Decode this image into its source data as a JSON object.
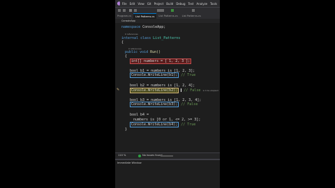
{
  "menu": {
    "items": [
      "File",
      "Edit",
      "View",
      "Git",
      "Project",
      "Build",
      "Debug",
      "Test",
      "Analyze",
      "Tools"
    ]
  },
  "tabs": [
    {
      "label": "Program.cs",
      "active": false
    },
    {
      "label": "List Patterns.cs",
      "active": true
    },
    {
      "label": "List Patterns.cs",
      "active": false
    },
    {
      "label": "List Patterns.cs",
      "active": false
    }
  ],
  "navbar": {
    "project": "ConsoleApp"
  },
  "code": {
    "line1": {
      "kw": "namespace",
      "name": "ConsoleApp;"
    },
    "refs1": "0 references",
    "line2": {
      "kw": "internal class",
      "name": "List_Patterns"
    },
    "brace_open": "{",
    "refs2": "0 references",
    "line3": {
      "kw": "public void",
      "name": "Run()"
    },
    "brace_open2": "{",
    "line4": "int[] numbers = [ 1, 2, 3 ];",
    "line5": "bool b1 = numbers is [1, 2, 3];",
    "line6": {
      "call": "Console.WriteLine(b1);",
      "comment": "// True"
    },
    "line7": "bool b2 = numbers is [1, 2, 4];",
    "line8": {
      "call": "Console.WriteLine(b2);",
      "comment": "// False"
    },
    "peek_hint": "≤ 1ms elapsed",
    "line9": "bool b3 = numbers is [1, 2, 3, 4];",
    "line10": {
      "call": "Console.WriteLine(b3);",
      "comment": "// False"
    },
    "line11": "bool b4 =",
    "line12": "numbers is [0 or 1, <= 2, >= 3];",
    "line13": {
      "call": "Console.WriteLine(b4);",
      "comment": "// True"
    },
    "brace_close": "}"
  },
  "status": {
    "zoom": "110 %",
    "issues": "No issues found"
  },
  "immediate": {
    "title": "Immediate Window"
  }
}
